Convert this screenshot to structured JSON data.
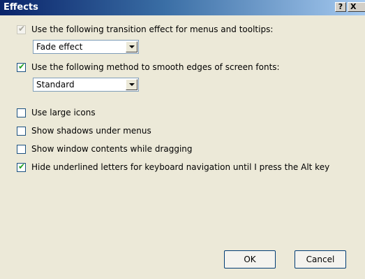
{
  "window": {
    "title": "Effects",
    "help_label": "?",
    "close_label": "X"
  },
  "options": {
    "transition": {
      "label": "Use the following transition effect for menus and tooltips:",
      "checked": true,
      "enabled": false,
      "selected": "Fade effect"
    },
    "smoothing": {
      "label": "Use the following method to smooth edges of screen fonts:",
      "checked": true,
      "enabled": true,
      "selected": "Standard"
    },
    "large_icons": {
      "label": "Use large icons",
      "checked": false
    },
    "shadows": {
      "label": "Show shadows under menus",
      "checked": false
    },
    "drag_contents": {
      "label": "Show window contents while dragging",
      "checked": false
    },
    "hide_underline": {
      "label": "Hide underlined letters for keyboard navigation until I press the Alt key",
      "checked": true
    }
  },
  "buttons": {
    "ok": "OK",
    "cancel": "Cancel"
  },
  "check_glyph": "✔"
}
